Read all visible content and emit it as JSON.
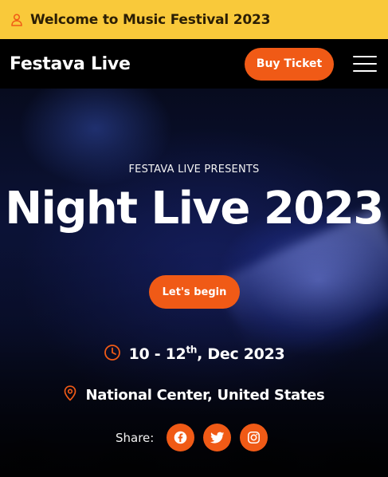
{
  "topbar": {
    "message": "Welcome to Music Festival 2023",
    "icon": "person-icon"
  },
  "navbar": {
    "brand": "Festava Live",
    "buy_label": "Buy Ticket",
    "menu_icon": "hamburger-menu-icon"
  },
  "hero": {
    "presents": "FESTAVA LIVE PRESENTS",
    "headline": "Night Live 2023",
    "cta_label": "Let's begin",
    "date_prefix": "10 - 12",
    "date_sup": "th",
    "date_suffix": ", Dec 2023",
    "venue": "National Center, United States",
    "share_label": "Share:",
    "social": [
      "facebook-icon",
      "twitter-icon",
      "instagram-icon"
    ]
  },
  "colors": {
    "accent": "#f05a16",
    "topbar_bg": "#f9c93a",
    "nav_bg": "#000000"
  }
}
